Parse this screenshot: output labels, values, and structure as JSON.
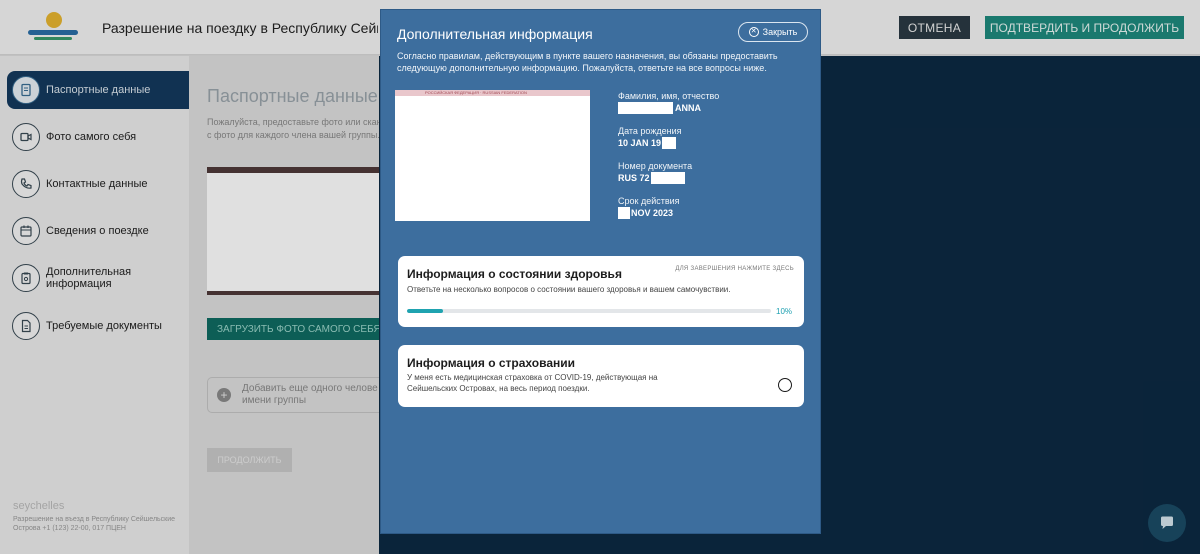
{
  "header": {
    "title": "Разрешение на поездку в Республику Сейшельские Острова",
    "cancel_label": "ОТМЕНА",
    "confirm_label": "ПОДТВЕРДИТЬ И ПРОДОЛЖИТЬ"
  },
  "sidebar": {
    "items": [
      {
        "label": "Паспортные данные"
      },
      {
        "label": "Фото самого себя"
      },
      {
        "label": "Контактные данные"
      },
      {
        "label": "Сведения о поездке"
      },
      {
        "label": "Дополнительная информация"
      },
      {
        "label": "Требуемые документы"
      }
    ],
    "footer_brand": "seychelles",
    "footer_text": "Разрешение на въезд в Республику Сейшельские Острова +1 (123) 22-00, 017 ПЦЕН"
  },
  "main": {
    "heading": "Паспортные данные",
    "subtitle_1": "Пожалуйста, предоставьте фото или скан",
    "subtitle_2": "с фото для каждого члена вашей группы.",
    "upload_label": "ЗАГРУЗИТЬ ФОТО САМОГО СЕБЯ",
    "add_member_line1": "Добавить еще одного челове",
    "add_member_line2": "имени группы",
    "continue_label": "ПРОДОЛЖИТЬ"
  },
  "modal": {
    "title": "Дополнительная информация",
    "close_label": "Закрыть",
    "intro": "Согласно правилам, действующим в пункте вашего назначения, вы обязаны предоставить следующую дополнительную информацию. Пожалуйста, ответьте на все вопросы ниже.",
    "passport_strip": "РОССИЙСКАЯ ФЕДЕРАЦИЯ · RUSSIAN FEDERATION",
    "fields": {
      "name_label": "Фамилия, имя, отчество",
      "name_value": "ANNA",
      "dob_label": "Дата рождения",
      "dob_value": "10 JAN 19",
      "doc_label": "Номер документа",
      "doc_value": "RUS 72",
      "exp_label": "Срок действия",
      "exp_value": "NOV 2023"
    },
    "health": {
      "title": "Информация о состоянии здоровья",
      "hint": "ДЛЯ ЗАВЕРШЕНИЯ НАЖМИТЕ ЗДЕСЬ",
      "description": "Ответьте на несколько вопросов о состоянии вашего здоровья и вашем самочувствии.",
      "progress_label": "10%",
      "progress_value": 10
    },
    "insurance": {
      "title": "Информация о страховании",
      "description_1": "У меня есть медицинская страховка от COVID-19, действующая на",
      "description_2": "Сейшельских Островах, на весь период поездки."
    }
  },
  "colors": {
    "modal_bg": "#3d6e9e",
    "accent_teal": "#1e8a7e",
    "progress": "#1fa3b0",
    "nav_active": "#143a5e"
  }
}
